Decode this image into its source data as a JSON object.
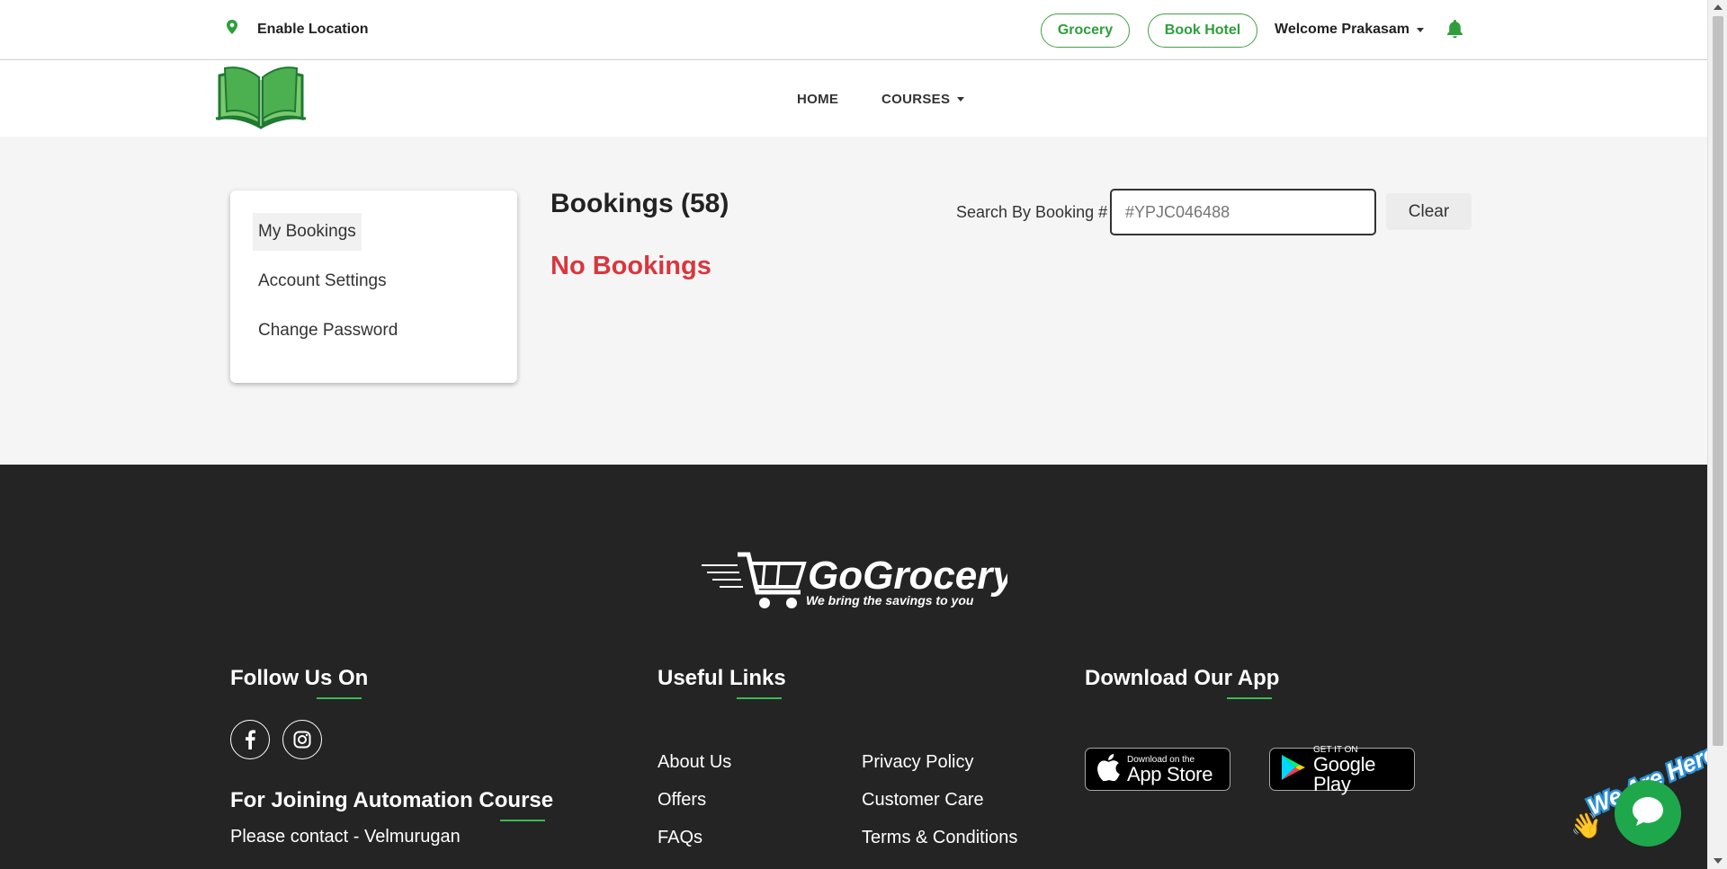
{
  "topbar": {
    "location_label": "Enable Location",
    "grocery_button": "Grocery",
    "book_hotel_button": "Book Hotel",
    "welcome_text": "Welcome Prakasam"
  },
  "nav": {
    "home": "HOME",
    "courses": "COURSES"
  },
  "sidebar": {
    "items": [
      {
        "label": "My Bookings",
        "active": true
      },
      {
        "label": "Account Settings",
        "active": false
      },
      {
        "label": "Change Password",
        "active": false
      }
    ]
  },
  "bookings": {
    "heading": "Bookings (58)",
    "empty_text": "No Bookings",
    "search_label": "Search By Booking #",
    "search_placeholder": "#YPJC046488",
    "clear_button": "Clear"
  },
  "footer": {
    "brand_name": "GoGrocery",
    "brand_tagline": "We bring the savings to you",
    "follow_heading": "Follow Us On",
    "useful_links_heading": "Useful Links",
    "download_heading": "Download Our App",
    "join_heading": "For Joining Automation Course",
    "contact_text": "Please contact - Velmurugan",
    "links_col1": [
      "About Us",
      "Offers",
      "FAQs"
    ],
    "links_col2": [
      "Privacy Policy",
      "Customer Care",
      "Terms & Conditions"
    ],
    "app_store": {
      "small": "Download on the",
      "big": "App Store"
    },
    "google_play": {
      "small": "GET IT ON",
      "big": "Google Play"
    }
  },
  "chat_widget": {
    "banner": "We Are Here!"
  },
  "colors": {
    "accent_green": "#2e9e3d",
    "error_red": "#d9363e",
    "footer_bg": "#242424"
  }
}
